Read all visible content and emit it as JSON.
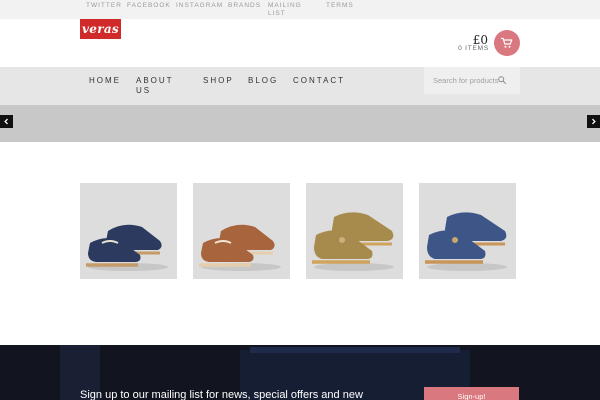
{
  "topbar": {
    "links": [
      "Twitter",
      "Facebook",
      "Instagram",
      "Brands",
      "Mailing List",
      "Terms"
    ]
  },
  "header": {
    "logo_text": "veras",
    "cart_total": "£0",
    "cart_items": "0 ITEMS",
    "cart_icon": "shopping-cart-icon"
  },
  "nav": {
    "items": [
      "Home",
      "About Us",
      "Shop",
      "Blog",
      "Contact"
    ],
    "search_placeholder": "Search for products",
    "search_icon": "search-icon"
  },
  "slider": {
    "prev_icon": "chevron-left-icon",
    "next_icon": "chevron-right-icon"
  },
  "products": [
    {
      "color": "navy",
      "hex": "#2b3a5e"
    },
    {
      "color": "tan",
      "hex": "#a8643c"
    },
    {
      "color": "olive-tan",
      "hex": "#a68b4c"
    },
    {
      "color": "blue",
      "hex": "#3e5687"
    }
  ],
  "footer": {
    "signup_text": "Sign up to our mailing list for news, special offers and new",
    "signup_button": "Sign-up!"
  },
  "colors": {
    "accent": "#d9787e",
    "logo": "#d12a2a",
    "footer_bg": "#121520"
  }
}
